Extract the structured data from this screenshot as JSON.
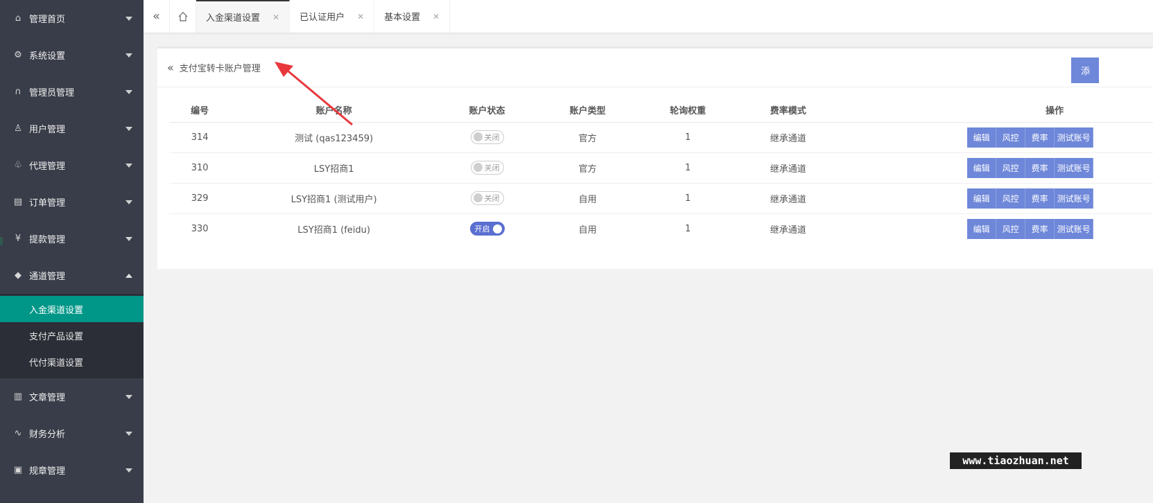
{
  "sidebar": {
    "items": [
      {
        "label": "管理首页",
        "icon": "home-icon"
      },
      {
        "label": "系统设置",
        "icon": "gear-icon"
      },
      {
        "label": "管理员管理",
        "icon": "headset-icon"
      },
      {
        "label": "用户管理",
        "icon": "user-icon"
      },
      {
        "label": "代理管理",
        "icon": "agent-icon"
      },
      {
        "label": "订单管理",
        "icon": "order-icon"
      },
      {
        "label": "提款管理",
        "icon": "yen-icon"
      },
      {
        "label": "通道管理",
        "icon": "diamond-icon"
      }
    ],
    "submenu": [
      "入金渠道设置",
      "支付产品设置",
      "代付渠道设置"
    ],
    "items_after": [
      {
        "label": "文章管理",
        "icon": "document-icon"
      },
      {
        "label": "财务分析",
        "icon": "chart-icon"
      },
      {
        "label": "规章管理",
        "icon": "rules-icon"
      }
    ]
  },
  "tabs": [
    {
      "label": "入金渠道设置"
    },
    {
      "label": "已认证用户"
    },
    {
      "label": "基本设置"
    }
  ],
  "card": {
    "title": "支付宝转卡账户管理",
    "add_label": "添"
  },
  "table": {
    "headers": [
      "编号",
      "账户名称",
      "账户状态",
      "账户类型",
      "轮询权重",
      "费率模式",
      "",
      "操作"
    ],
    "rows": [
      {
        "id": "314",
        "name": "测试 (qas123459)",
        "state": "关闭",
        "on": false,
        "type": "官方",
        "weight": "1",
        "rate": "继承通道"
      },
      {
        "id": "310",
        "name": "LSY招商1",
        "state": "关闭",
        "on": false,
        "type": "官方",
        "weight": "1",
        "rate": "继承通道"
      },
      {
        "id": "329",
        "name": "LSY招商1 (测试用户)",
        "state": "关闭",
        "on": false,
        "type": "自用",
        "weight": "1",
        "rate": "继承通道"
      },
      {
        "id": "330",
        "name": "LSY招商1 (feidu)",
        "state": "开启",
        "on": true,
        "type": "自用",
        "weight": "1",
        "rate": "继承通道"
      }
    ],
    "ops": [
      "编辑",
      "风控",
      "费率",
      "测试账号"
    ]
  },
  "watermark": "www.tiaozhuan.net",
  "colors": {
    "sidebar_bg": "#393d49",
    "active_green": "#009688",
    "button_blue": "#6e87d9",
    "annotation_red": "#e8383d"
  }
}
